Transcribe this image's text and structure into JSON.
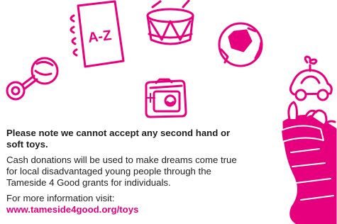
{
  "colors": {
    "accent": "#e6007e",
    "text": "#1f1f1f",
    "background": "#ffffff"
  },
  "illustrations": {
    "book_text": "A-Z",
    "icons": [
      "rattle-icon",
      "a-z-book-icon",
      "drum-icon",
      "football-icon",
      "toy-car-icon",
      "camera-icon",
      "christmas-stocking-icon"
    ]
  },
  "notice": {
    "heading": "Please note we cannot accept any second hand or soft toys.",
    "body": "Cash donations will be used to make dreams come true for local disadvantaged young people through the Tameside 4 Good grants for individuals.",
    "more_info": "For more information visit:",
    "link": "www.tameside4good.org/toys"
  }
}
